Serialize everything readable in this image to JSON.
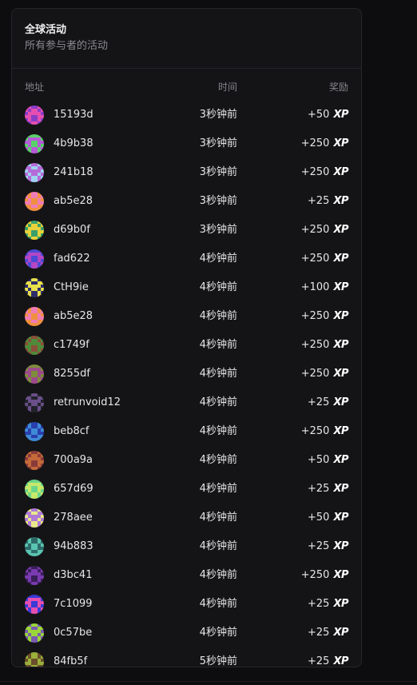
{
  "header": {
    "title": "全球活动",
    "subtitle": "所有参与者的活动"
  },
  "columns": {
    "address": "地址",
    "time": "时间",
    "reward": "奖励"
  },
  "xp_label": "XP",
  "rows": [
    {
      "address": "15193d",
      "time": "3秒钟前",
      "reward": "+50",
      "colors": [
        "#8a3cc9",
        "#e64fb0"
      ]
    },
    {
      "address": "4b9b38",
      "time": "3秒钟前",
      "reward": "+250",
      "colors": [
        "#59d16a",
        "#b65ad8"
      ]
    },
    {
      "address": "241b18",
      "time": "3秒钟前",
      "reward": "+250",
      "colors": [
        "#9fd2f0",
        "#b66ad9"
      ]
    },
    {
      "address": "ab5e28",
      "time": "3秒钟前",
      "reward": "+25",
      "colors": [
        "#f07cb6",
        "#f0903f"
      ]
    },
    {
      "address": "d69b0f",
      "time": "3秒钟前",
      "reward": "+250",
      "colors": [
        "#3aa06a",
        "#e9d23c"
      ]
    },
    {
      "address": "fad622",
      "time": "4秒钟前",
      "reward": "+250",
      "colors": [
        "#4a4ad6",
        "#b446c4"
      ]
    },
    {
      "address": "CtH9ie",
      "time": "4秒钟前",
      "reward": "+100",
      "colors": [
        "#2d2d6a",
        "#e8e04a"
      ]
    },
    {
      "address": "ab5e28",
      "time": "4秒钟前",
      "reward": "+250",
      "colors": [
        "#f07cb6",
        "#f0903f"
      ]
    },
    {
      "address": "c1749f",
      "time": "4秒钟前",
      "reward": "+250",
      "colors": [
        "#8a4f3a",
        "#4f8a3a"
      ]
    },
    {
      "address": "8255df",
      "time": "4秒钟前",
      "reward": "+250",
      "colors": [
        "#7d8d3a",
        "#9c4a8c"
      ]
    },
    {
      "address": "retrunvoid12",
      "time": "4秒钟前",
      "reward": "+25",
      "colors": [
        "#22222a",
        "#6a4f8a"
      ]
    },
    {
      "address": "beb8cf",
      "time": "4秒钟前",
      "reward": "+250",
      "colors": [
        "#2a3fae",
        "#3f8ad6"
      ]
    },
    {
      "address": "700a9a",
      "time": "4秒钟前",
      "reward": "+50",
      "colors": [
        "#8a3a3a",
        "#c46a3a"
      ]
    },
    {
      "address": "657d69",
      "time": "4秒钟前",
      "reward": "+25",
      "colors": [
        "#6ad68a",
        "#c8e86a"
      ]
    },
    {
      "address": "278aee",
      "time": "4秒钟前",
      "reward": "+50",
      "colors": [
        "#e8e88a",
        "#b07ad6"
      ]
    },
    {
      "address": "94b883",
      "time": "4秒钟前",
      "reward": "+25",
      "colors": [
        "#2f6a6a",
        "#5ac4b0"
      ]
    },
    {
      "address": "d3bc41",
      "time": "4秒钟前",
      "reward": "+250",
      "colors": [
        "#3a1f5a",
        "#7a3ab0"
      ]
    },
    {
      "address": "7c1099",
      "time": "4秒钟前",
      "reward": "+25",
      "colors": [
        "#3a3ad6",
        "#e64fb0"
      ]
    },
    {
      "address": "0c57be",
      "time": "4秒钟前",
      "reward": "+25",
      "colors": [
        "#7a5ab0",
        "#9ad63a"
      ]
    },
    {
      "address": "84fb5f",
      "time": "5秒钟前",
      "reward": "+25",
      "colors": [
        "#9ab03a",
        "#6a4f2a"
      ]
    }
  ]
}
